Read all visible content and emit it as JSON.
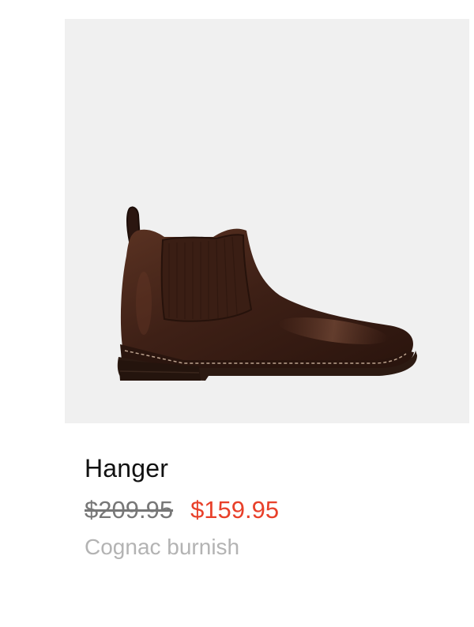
{
  "product": {
    "name": "Hanger",
    "original_price": "$209.95",
    "sale_price": "$159.95",
    "color": "Cognac burnish",
    "image_background": "#f0f0f0",
    "boot_color": "#3e2016",
    "sale_price_color": "#e8402a"
  }
}
